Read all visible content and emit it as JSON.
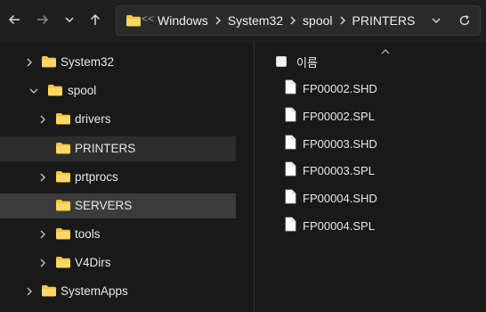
{
  "toolbar": {
    "back_icon": "arrow-left-icon",
    "forward_icon": "arrow-right-icon",
    "recent_icon": "chevron-down-icon",
    "up_icon": "arrow-up-icon"
  },
  "address": {
    "overflow": "<<",
    "crumbs": [
      "Windows",
      "System32",
      "spool",
      "PRINTERS"
    ]
  },
  "tree": [
    {
      "label": "System32",
      "expanded": false,
      "state": "normal"
    },
    {
      "label": "spool",
      "expanded": true,
      "state": "normal"
    },
    {
      "label": "drivers",
      "expanded": false,
      "state": "normal"
    },
    {
      "label": "PRINTERS",
      "expanded": null,
      "state": "selected"
    },
    {
      "label": "prtprocs",
      "expanded": false,
      "state": "normal"
    },
    {
      "label": "SERVERS",
      "expanded": null,
      "state": "hover"
    },
    {
      "label": "tools",
      "expanded": false,
      "state": "normal"
    },
    {
      "label": "V4Dirs",
      "expanded": false,
      "state": "normal"
    },
    {
      "label": "SystemApps",
      "expanded": false,
      "state": "normal"
    }
  ],
  "content": {
    "column_name": "이름",
    "files": [
      "FP00002.SHD",
      "FP00002.SPL",
      "FP00003.SHD",
      "FP00003.SPL",
      "FP00004.SHD",
      "FP00004.SPL"
    ]
  },
  "colors": {
    "folder": "#f5c542",
    "accent": "#e8e8e8",
    "selected": "#2d2d2d",
    "hover": "#3b3b3b"
  }
}
